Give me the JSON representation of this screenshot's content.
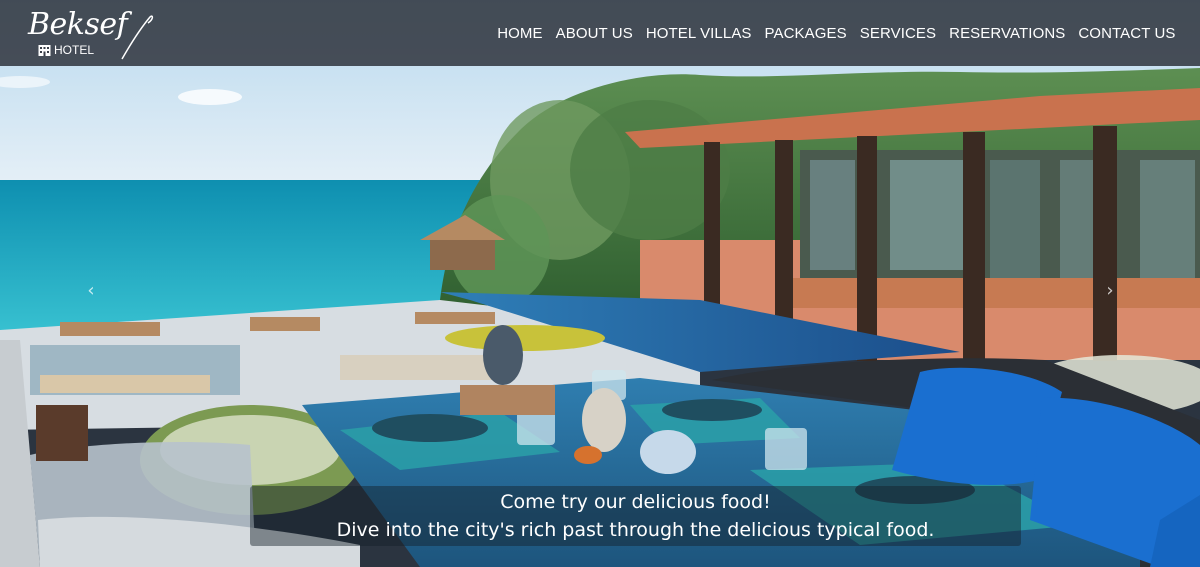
{
  "brand": {
    "script_name": "Beksef",
    "sub_name": "HOTEL"
  },
  "nav": {
    "items": [
      {
        "label": "HOME"
      },
      {
        "label": "ABOUT US"
      },
      {
        "label": "HOTEL VILLAS"
      },
      {
        "label": "PACKAGES"
      },
      {
        "label": "SERVICES"
      },
      {
        "label": "RESERVATIONS"
      },
      {
        "label": "CONTACT US"
      }
    ]
  },
  "carousel": {
    "prev_glyph": "‹",
    "next_glyph": "›",
    "caption": {
      "title": "Come try our delicious food!",
      "text": "Dive into the city's rich past through the delicious typical food."
    }
  },
  "colors": {
    "nav_bg": "#282c34",
    "sea": "#1ea7c0",
    "table_top": "#2a6d9a",
    "cushion": "#1565c0",
    "roof": "#c9724e"
  }
}
